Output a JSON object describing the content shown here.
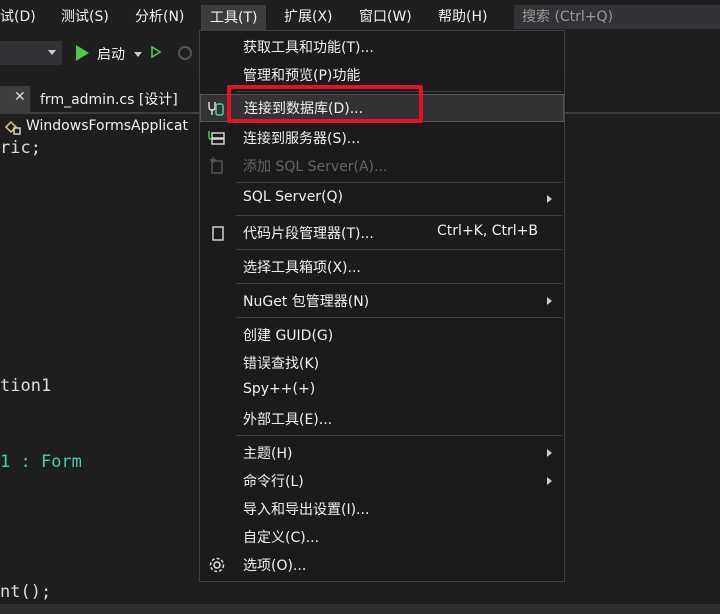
{
  "menubar": {
    "items": [
      "试(D)",
      "测试(S)",
      "分析(N)",
      "工具(T)",
      "扩展(X)",
      "窗口(W)",
      "帮助(H)"
    ],
    "search_placeholder": "搜索 (Ctrl+Q)"
  },
  "toolbar": {
    "start_label": "启动"
  },
  "tabs": {
    "file_tab": "frm_admin.cs [设计]"
  },
  "navbar": {
    "label": "WindowsFormsApplicat"
  },
  "code": {
    "line1": "ric;",
    "line2": "tion1",
    "line3_a": "1 : ",
    "line3_b": "Form",
    "line4": "nt();"
  },
  "tools_menu": {
    "items": [
      {
        "label": "获取工具和功能(T)..."
      },
      {
        "label": "管理和预览(P)功能"
      },
      {
        "label": "连接到数据库(D)...",
        "icon": "database-connect-icon"
      },
      {
        "label": "连接到服务器(S)...",
        "icon": "server-connect-icon"
      },
      {
        "label": "添加 SQL Server(A)...",
        "icon": "add-sql-server-icon",
        "disabled": true
      },
      {
        "label": "SQL Server(Q)",
        "submenu": true
      },
      {
        "label": "代码片段管理器(T)...",
        "shortcut": "Ctrl+K, Ctrl+B",
        "icon": "snippet-icon"
      },
      {
        "label": "选择工具箱项(X)..."
      },
      {
        "label": "NuGet 包管理器(N)",
        "submenu": true
      },
      {
        "label": "创建 GUID(G)"
      },
      {
        "label": "错误查找(K)"
      },
      {
        "label": "Spy++(+)"
      },
      {
        "label": "外部工具(E)..."
      },
      {
        "label": "主题(H)",
        "submenu": true
      },
      {
        "label": "命令行(L)",
        "submenu": true
      },
      {
        "label": "导入和导出设置(I)..."
      },
      {
        "label": "自定义(C)..."
      },
      {
        "label": "选项(O)...",
        "icon": "gear-icon"
      }
    ]
  },
  "colors": {
    "highlight_box": "#e81123",
    "run_green": "#4ec94e",
    "type_teal": "#4ec9b0"
  }
}
